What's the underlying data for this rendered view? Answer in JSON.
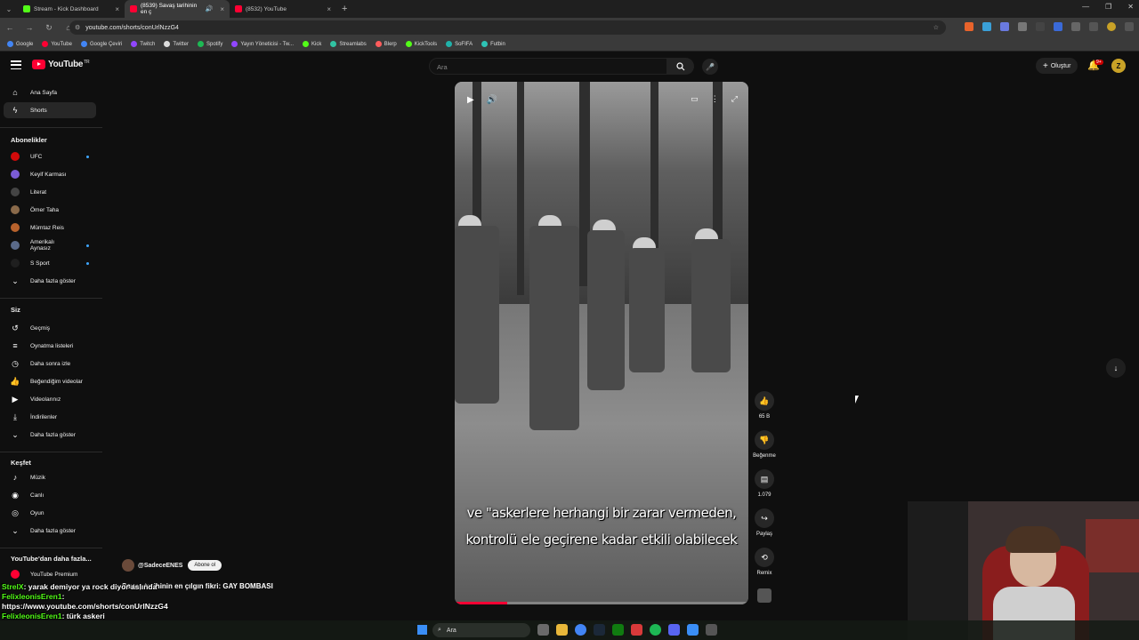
{
  "browser": {
    "tabs": [
      {
        "title": "Stream - Kick Dashboard",
        "color": "#53fc18",
        "active": false
      },
      {
        "title": "(8539) Savaş tarihinin en ç",
        "color": "#ff0033",
        "active": true
      },
      {
        "title": "(8532) YouTube",
        "color": "#ff0033",
        "active": false
      }
    ],
    "url": "youtube.com/shorts/conUrlNzzG4",
    "bookmarks": [
      {
        "label": "Google",
        "color": "#4285f4"
      },
      {
        "label": "YouTube",
        "color": "#ff0033"
      },
      {
        "label": "Google Çeviri",
        "color": "#4285f4"
      },
      {
        "label": "Twitch",
        "color": "#9146ff"
      },
      {
        "label": "Twitter",
        "color": "#dddddd"
      },
      {
        "label": "Spotify",
        "color": "#1db954"
      },
      {
        "label": "Yayın Yöneticisi - Tw...",
        "color": "#9146ff"
      },
      {
        "label": "Kick",
        "color": "#53fc18"
      },
      {
        "label": "Streamlabs",
        "color": "#31c3a2"
      },
      {
        "label": "Blerp",
        "color": "#ff5c5c"
      },
      {
        "label": "KickTools",
        "color": "#53fc18"
      },
      {
        "label": "SoFIFA",
        "color": "#20b2aa"
      },
      {
        "label": "Futbin",
        "color": "#2ec4b6"
      }
    ]
  },
  "header": {
    "search_placeholder": "Ara",
    "create_label": "Oluştur",
    "notif_badge": "9+",
    "avatar_letter": "Z"
  },
  "sidebar": {
    "main": [
      {
        "label": "Ana Sayfa",
        "icon": "home-icon",
        "glyph": "⌂"
      },
      {
        "label": "Shorts",
        "icon": "shorts-icon",
        "glyph": "ϟ"
      }
    ],
    "subs_title": "Abonelikler",
    "subs": [
      {
        "label": "UFC",
        "color": "#d20a0a",
        "live": true
      },
      {
        "label": "Keyif Karması",
        "color": "#7b5cd6",
        "live": false
      },
      {
        "label": "Literat",
        "color": "#444444",
        "live": false
      },
      {
        "label": "Ömer Taha",
        "color": "#8a6a4a",
        "live": false
      },
      {
        "label": "Mümtaz Reis",
        "color": "#b8622c",
        "live": false
      },
      {
        "label": "Amerikalı Aynasız",
        "color": "#5a6a8a",
        "live": true
      },
      {
        "label": "S Sport",
        "color": "#1f1f1f",
        "live": true
      }
    ],
    "subs_more": "Daha fazla göster",
    "you_title": "Siz",
    "you": [
      {
        "label": "Geçmiş",
        "glyph": "↺"
      },
      {
        "label": "Oynatma listeleri",
        "glyph": "≡"
      },
      {
        "label": "Daha sonra izle",
        "glyph": "◷"
      },
      {
        "label": "Beğendiğim videolar",
        "glyph": "👍"
      },
      {
        "label": "Videolarınız",
        "glyph": "▶"
      },
      {
        "label": "İndirilenler",
        "glyph": "⤓"
      }
    ],
    "you_more": "Daha fazla göster",
    "explore_title": "Keşfet",
    "explore": [
      {
        "label": "Müzik",
        "glyph": "♪"
      },
      {
        "label": "Canlı",
        "glyph": "◉"
      },
      {
        "label": "Oyun",
        "glyph": "◎"
      }
    ],
    "explore_more": "Daha fazla göster",
    "more_title": "YouTube'dan daha fazla...",
    "more": [
      {
        "label": "YouTube Premium",
        "color": "#ff0033"
      }
    ]
  },
  "video": {
    "caption_line1": "ve \"askerlere herhangi bir zarar vermeden,",
    "caption_line2": "kontrolü ele geçirene kadar etkili olabilecek",
    "progress": 0.18,
    "channel": "@SadeceENES",
    "subscribe_label": "Abone ol",
    "title": "Savaş tarihinin en çılgın fikri: GAY BOMBASI"
  },
  "actions": [
    {
      "name": "like",
      "glyph": "👍",
      "label": "65 B"
    },
    {
      "name": "dislike",
      "glyph": "👎",
      "label": "Beğenme"
    },
    {
      "name": "comments",
      "glyph": "▤",
      "label": "1.079"
    },
    {
      "name": "share",
      "glyph": "↪",
      "label": "Paylaş"
    },
    {
      "name": "remix",
      "glyph": "⟲",
      "label": "Remix"
    }
  ],
  "chat": [
    {
      "user": "StrelX",
      "msg": ": yarak demiyor ya rock diyor aslında"
    },
    {
      "user": "FelixleonisEren1",
      "msg": ":"
    },
    {
      "user": "",
      "msg": "https://www.youtube.com/shorts/conUrlNzzG4"
    },
    {
      "user": "FelixleonisEren1",
      "msg": ": türk askeri"
    }
  ],
  "taskbar": {
    "search_label": "Ara"
  }
}
